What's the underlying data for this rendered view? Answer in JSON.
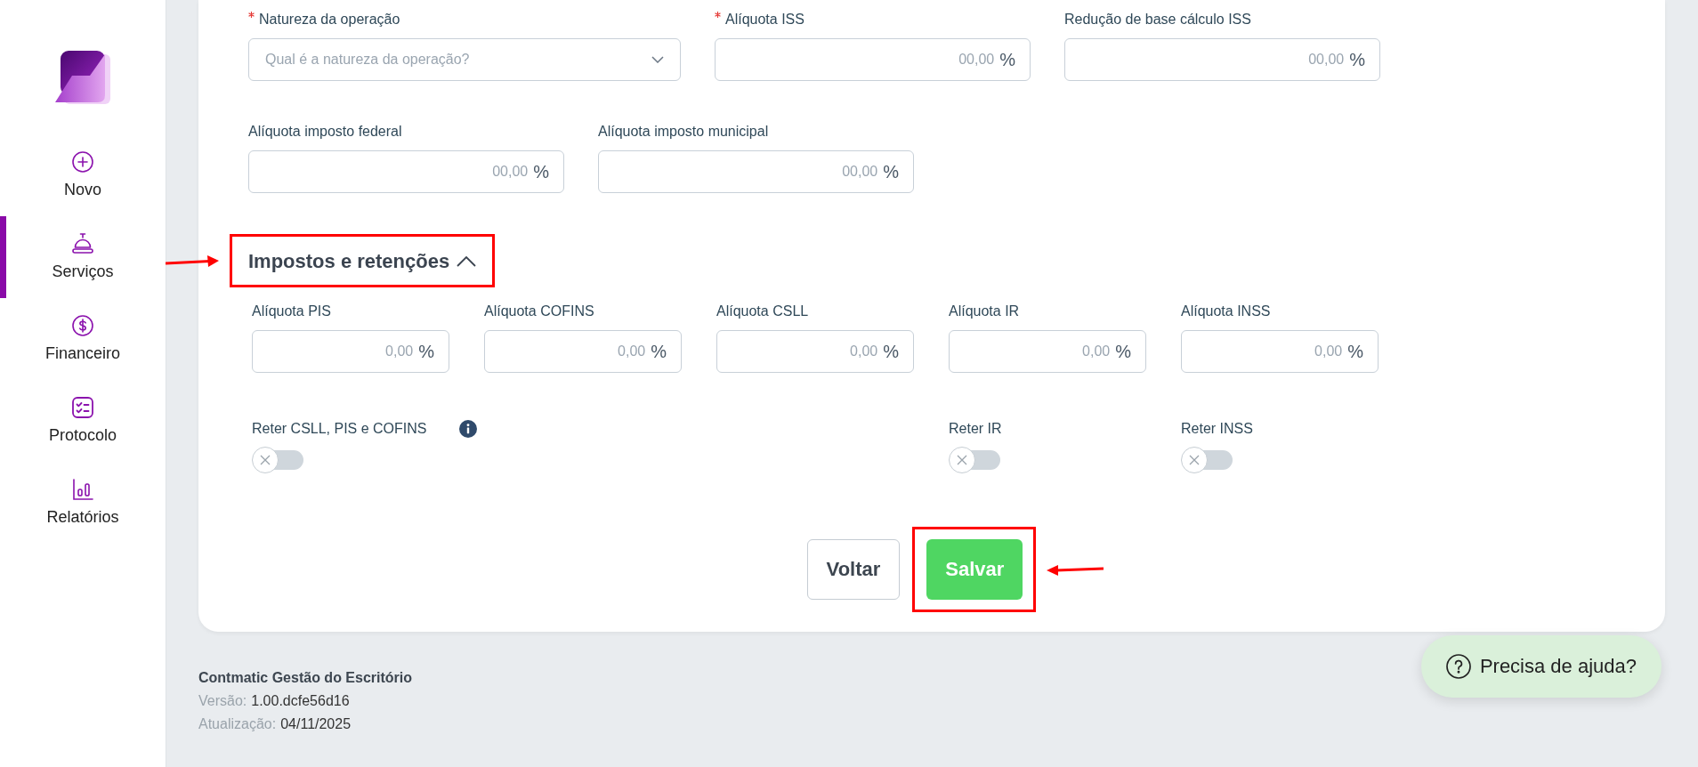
{
  "sidebar": {
    "items": [
      {
        "label": "Novo",
        "selected": false
      },
      {
        "label": "Serviços",
        "selected": true
      },
      {
        "label": "Financeiro",
        "selected": false
      },
      {
        "label": "Protocolo",
        "selected": false
      },
      {
        "label": "Relatórios",
        "selected": false
      }
    ]
  },
  "form": {
    "rows": [
      {
        "fields": [
          {
            "kind": "select",
            "label": "Natureza da operação",
            "required": true,
            "placeholder": "Qual é a natureza da operação?"
          },
          {
            "kind": "percent",
            "label": "Alíquota ISS",
            "required": true,
            "placeholder": "00,00",
            "unit": "%"
          },
          {
            "kind": "percent",
            "label": "Redução de base cálculo ISS",
            "required": false,
            "placeholder": "00,00",
            "unit": "%"
          }
        ]
      },
      {
        "fields": [
          {
            "kind": "percent",
            "label": "Alíquota imposto federal",
            "required": false,
            "placeholder": "00,00",
            "unit": "%"
          },
          {
            "kind": "percent",
            "label": "Alíquota imposto municipal",
            "required": false,
            "placeholder": "00,00",
            "unit": "%"
          }
        ]
      }
    ]
  },
  "taxes": {
    "title": "Impostos e retenções",
    "expanded": true,
    "highlighted": true,
    "fields": [
      {
        "label": "Alíquota PIS",
        "placeholder": "0,00",
        "unit": "%"
      },
      {
        "label": "Alíquota COFINS",
        "placeholder": "0,00",
        "unit": "%"
      },
      {
        "label": "Alíquota CSLL",
        "placeholder": "0,00",
        "unit": "%"
      },
      {
        "label": "Alíquota IR",
        "placeholder": "0,00",
        "unit": "%"
      },
      {
        "label": "Alíquota INSS",
        "placeholder": "0,00",
        "unit": "%"
      }
    ],
    "toggles": [
      {
        "label": "Reter CSLL, PIS e COFINS",
        "info": true,
        "checked": false
      },
      {
        "label": "Reter IR",
        "info": false,
        "checked": false
      },
      {
        "label": "Reter INSS",
        "info": false,
        "checked": false
      }
    ]
  },
  "buttons": [
    {
      "kind": "secondary",
      "label": "Voltar",
      "highlighted": false
    },
    {
      "kind": "primary",
      "label": "Salvar",
      "highlighted": true
    }
  ],
  "footer": {
    "title": "Contmatic Gestão do Escritório",
    "lines": [
      {
        "label": "Versão:",
        "value": "1.00.dcfe56d16"
      },
      {
        "label": "Atualização:",
        "value": "04/11/2025"
      }
    ]
  },
  "help_button": {
    "label": "Precisa de ajuda?"
  }
}
